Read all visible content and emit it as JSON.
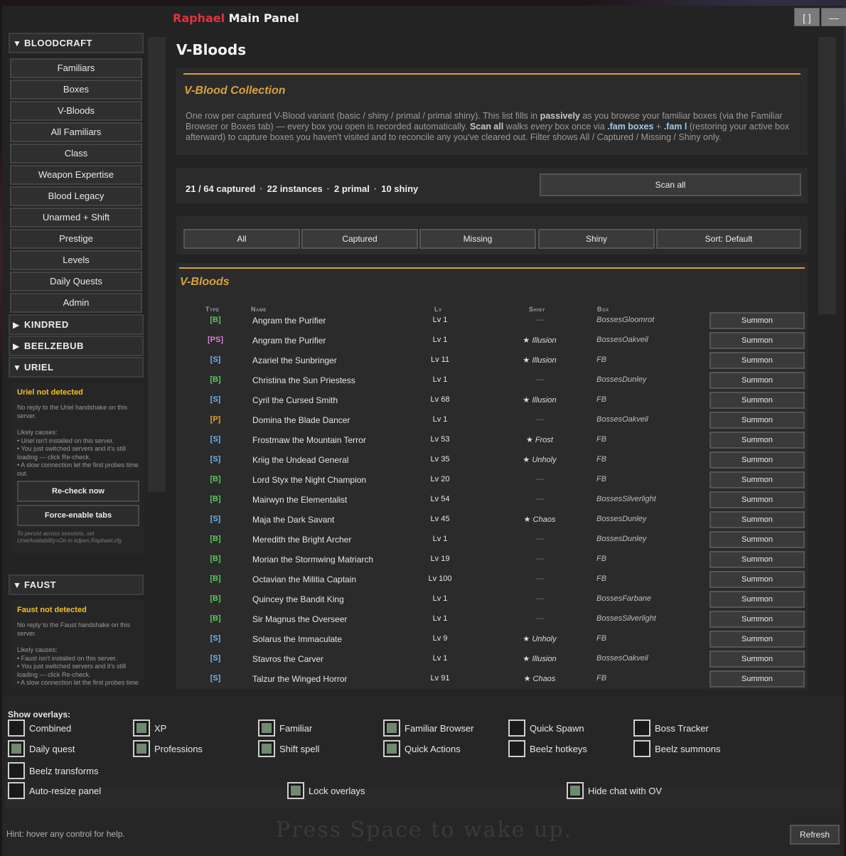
{
  "window": {
    "brand": "Raphael",
    "title": "Main Panel",
    "max_label": "[ ]",
    "min_label": "—"
  },
  "sidebar": {
    "bloodcraft": "BLOODCRAFT",
    "items": [
      "Familiars",
      "Boxes",
      "V-Bloods",
      "All Familiars",
      "Class",
      "Weapon Expertise",
      "Blood Legacy",
      "Unarmed + Shift",
      "Prestige",
      "Levels",
      "Daily Quests",
      "Admin"
    ],
    "kindred": "KINDRED",
    "beelzebub": "BEELZEBUB",
    "uriel": "URIEL",
    "faust": "FAUST",
    "uriel_box": {
      "title": "Uriel not detected",
      "line1": "No reply to the Uriel handshake on this server.",
      "causes_head": "Likely causes:",
      "cause1": "• Uriel isn't installed on this server.",
      "cause2": "• You just switched servers and it's still loading — click Re-check.",
      "cause3": "• A slow connection let the first probes time out.",
      "recheck": "Re-check now",
      "force": "Force-enable tabs",
      "note": "To persist across sessions, set UrielAvailability=On in kdpen.Raphael.cfg."
    },
    "faust_box": {
      "title": "Faust not detected",
      "line1": "No reply to the Faust handshake on this server.",
      "causes_head": "Likely causes:",
      "cause1": "• Faust isn't installed on this server.",
      "cause2": "• You just switched servers and it's still loading — click Re-check.",
      "cause3": "• A slow connection let the first probes time out."
    }
  },
  "main": {
    "page_title": "V-Bloods",
    "collection_title": "V-Blood Collection",
    "desc": {
      "p1": "One row per captured V-Blood variant (basic / shiny / primal / primal shiny). This list fills in ",
      "b1": "passively",
      "p2": " as you browse your familiar boxes (via the Familiar Browser or Boxes tab) — every box you open is recorded automatically. ",
      "b2": "Scan all",
      "p3": " walks ",
      "i1": "every",
      "p4": " box once via ",
      "c1": ".fam boxes",
      "p5": " + ",
      "c2": ".fam l",
      "p6": " (restoring your active box afterward) to capture boxes you haven't visited and to reconcile any you've cleared out. Filter shows All / Captured / Missing / Shiny only."
    },
    "stats": {
      "captured": "21 / 64 captured",
      "instances": "22 instances",
      "primal": "2 primal",
      "shiny": "10 shiny",
      "sep": "·"
    },
    "scan_all": "Scan all",
    "filters": [
      "All",
      "Captured",
      "Missing",
      "Shiny",
      "Sort: Default"
    ],
    "table_title": "V-Bloods",
    "columns": {
      "type": "Type",
      "name": "Name",
      "lv": "Lv",
      "shiny": "Shiny",
      "box": "Box"
    },
    "rows": [
      {
        "type": "[B]",
        "cls": "B",
        "name": "Angram the Purifier",
        "lv": "Lv 1",
        "shiny": "—",
        "box": "BossesGloomrot"
      },
      {
        "type": "[PS]",
        "cls": "PS",
        "name": "Angram the Purifier",
        "lv": "Lv 1",
        "shiny": "★ Illusion",
        "box": "BossesOakveil"
      },
      {
        "type": "[S]",
        "cls": "S",
        "name": "Azariel the Sunbringer",
        "lv": "Lv 11",
        "shiny": "★ Illusion",
        "box": "FB"
      },
      {
        "type": "[B]",
        "cls": "B",
        "name": "Christina the Sun Priestess",
        "lv": "Lv 1",
        "shiny": "—",
        "box": "BossesDunley"
      },
      {
        "type": "[S]",
        "cls": "S",
        "name": "Cyril the Cursed Smith",
        "lv": "Lv 68",
        "shiny": "★ Illusion",
        "box": "FB"
      },
      {
        "type": "[P]",
        "cls": "P",
        "name": "Domina the Blade Dancer",
        "lv": "Lv 1",
        "shiny": "—",
        "box": "BossesOakveil"
      },
      {
        "type": "[S]",
        "cls": "S",
        "name": "Frostmaw the Mountain Terror",
        "lv": "Lv 53",
        "shiny": "★ Frost",
        "box": "FB"
      },
      {
        "type": "[S]",
        "cls": "S",
        "name": "Kriig the Undead General",
        "lv": "Lv 35",
        "shiny": "★ Unholy",
        "box": "FB"
      },
      {
        "type": "[B]",
        "cls": "B",
        "name": "Lord Styx the Night Champion",
        "lv": "Lv 20",
        "shiny": "—",
        "box": "FB"
      },
      {
        "type": "[B]",
        "cls": "B",
        "name": "Mairwyn the Elementalist",
        "lv": "Lv 54",
        "shiny": "—",
        "box": "BossesSilverlight"
      },
      {
        "type": "[S]",
        "cls": "S",
        "name": "Maja the Dark Savant",
        "lv": "Lv 45",
        "shiny": "★ Chaos",
        "box": "BossesDunley"
      },
      {
        "type": "[B]",
        "cls": "B",
        "name": "Meredith the Bright Archer",
        "lv": "Lv 1",
        "shiny": "—",
        "box": "BossesDunley"
      },
      {
        "type": "[B]",
        "cls": "B",
        "name": "Morian the Stormwing Matriarch",
        "lv": "Lv 19",
        "shiny": "—",
        "box": "FB"
      },
      {
        "type": "[B]",
        "cls": "B",
        "name": "Octavian the Militia Captain",
        "lv": "Lv 100",
        "shiny": "—",
        "box": "FB"
      },
      {
        "type": "[B]",
        "cls": "B",
        "name": "Quincey the Bandit King",
        "lv": "Lv 1",
        "shiny": "—",
        "box": "BossesFarbane"
      },
      {
        "type": "[B]",
        "cls": "B",
        "name": "Sir Magnus the Overseer",
        "lv": "Lv 1",
        "shiny": "—",
        "box": "BossesSilverlight"
      },
      {
        "type": "[S]",
        "cls": "S",
        "name": "Solarus the Immaculate",
        "lv": "Lv 9",
        "shiny": "★ Unholy",
        "box": "FB"
      },
      {
        "type": "[S]",
        "cls": "S",
        "name": "Stavros the Carver",
        "lv": "Lv 1",
        "shiny": "★ Illusion",
        "box": "BossesOakveil"
      },
      {
        "type": "[S]",
        "cls": "S",
        "name": "Talzur the Winged Horror",
        "lv": "Lv 91",
        "shiny": "★ Chaos",
        "box": "FB"
      }
    ],
    "summon_label": "Summon"
  },
  "overlays": {
    "title": "Show overlays:",
    "items": [
      {
        "label": "Combined",
        "checked": false
      },
      {
        "label": "XP",
        "checked": true
      },
      {
        "label": "Familiar",
        "checked": true
      },
      {
        "label": "Familiar Browser",
        "checked": true
      },
      {
        "label": "Quick Spawn",
        "checked": false
      },
      {
        "label": "Boss Tracker",
        "checked": false
      },
      {
        "label": "Daily quest",
        "checked": true
      },
      {
        "label": "Professions",
        "checked": true
      },
      {
        "label": "Shift spell",
        "checked": true
      },
      {
        "label": "Quick Actions",
        "checked": true
      },
      {
        "label": "Beelz hotkeys",
        "checked": false
      },
      {
        "label": "Beelz summons",
        "checked": false
      },
      {
        "label": "Beelz transforms",
        "checked": false
      },
      {
        "label": "Auto-resize panel",
        "checked": false
      },
      {
        "label": "Lock overlays",
        "checked": true
      },
      {
        "label": "Hide chat with OV",
        "checked": true
      }
    ],
    "hint": "Hint: hover any control for help.",
    "refresh": "Refresh",
    "background_text": "Press Space to wake up."
  }
}
